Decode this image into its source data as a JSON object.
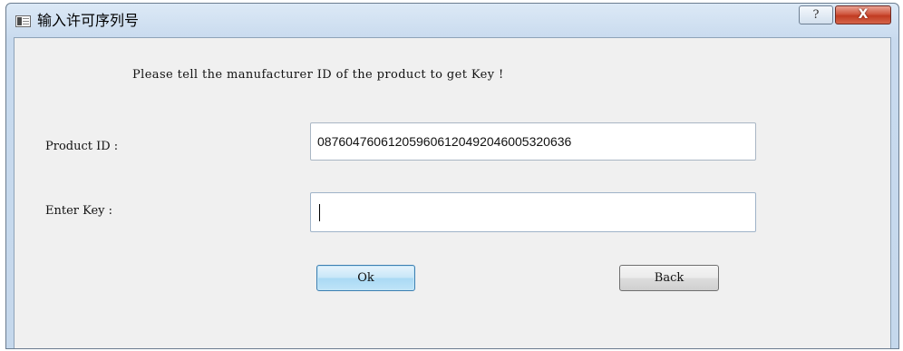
{
  "window": {
    "title": "输入许可序列号",
    "help_label": "?",
    "close_label": "X"
  },
  "dialog": {
    "message": "Please tell the manufacturer ID of the product to get Key !",
    "product_id_label": "Product ID :",
    "product_id_value": "08760476061205960612049204600532 0636",
    "enter_key_label": "Enter Key :",
    "enter_key_value": "",
    "ok_label": "Ok",
    "back_label": "Back"
  },
  "colors": {
    "frame": "#c8daee",
    "client": "#f0f0f0",
    "close_button": "#c13b21",
    "ok_button_border": "#3c7fb1"
  },
  "icons": [
    "app-window-icon",
    "help-icon",
    "close-icon"
  ]
}
